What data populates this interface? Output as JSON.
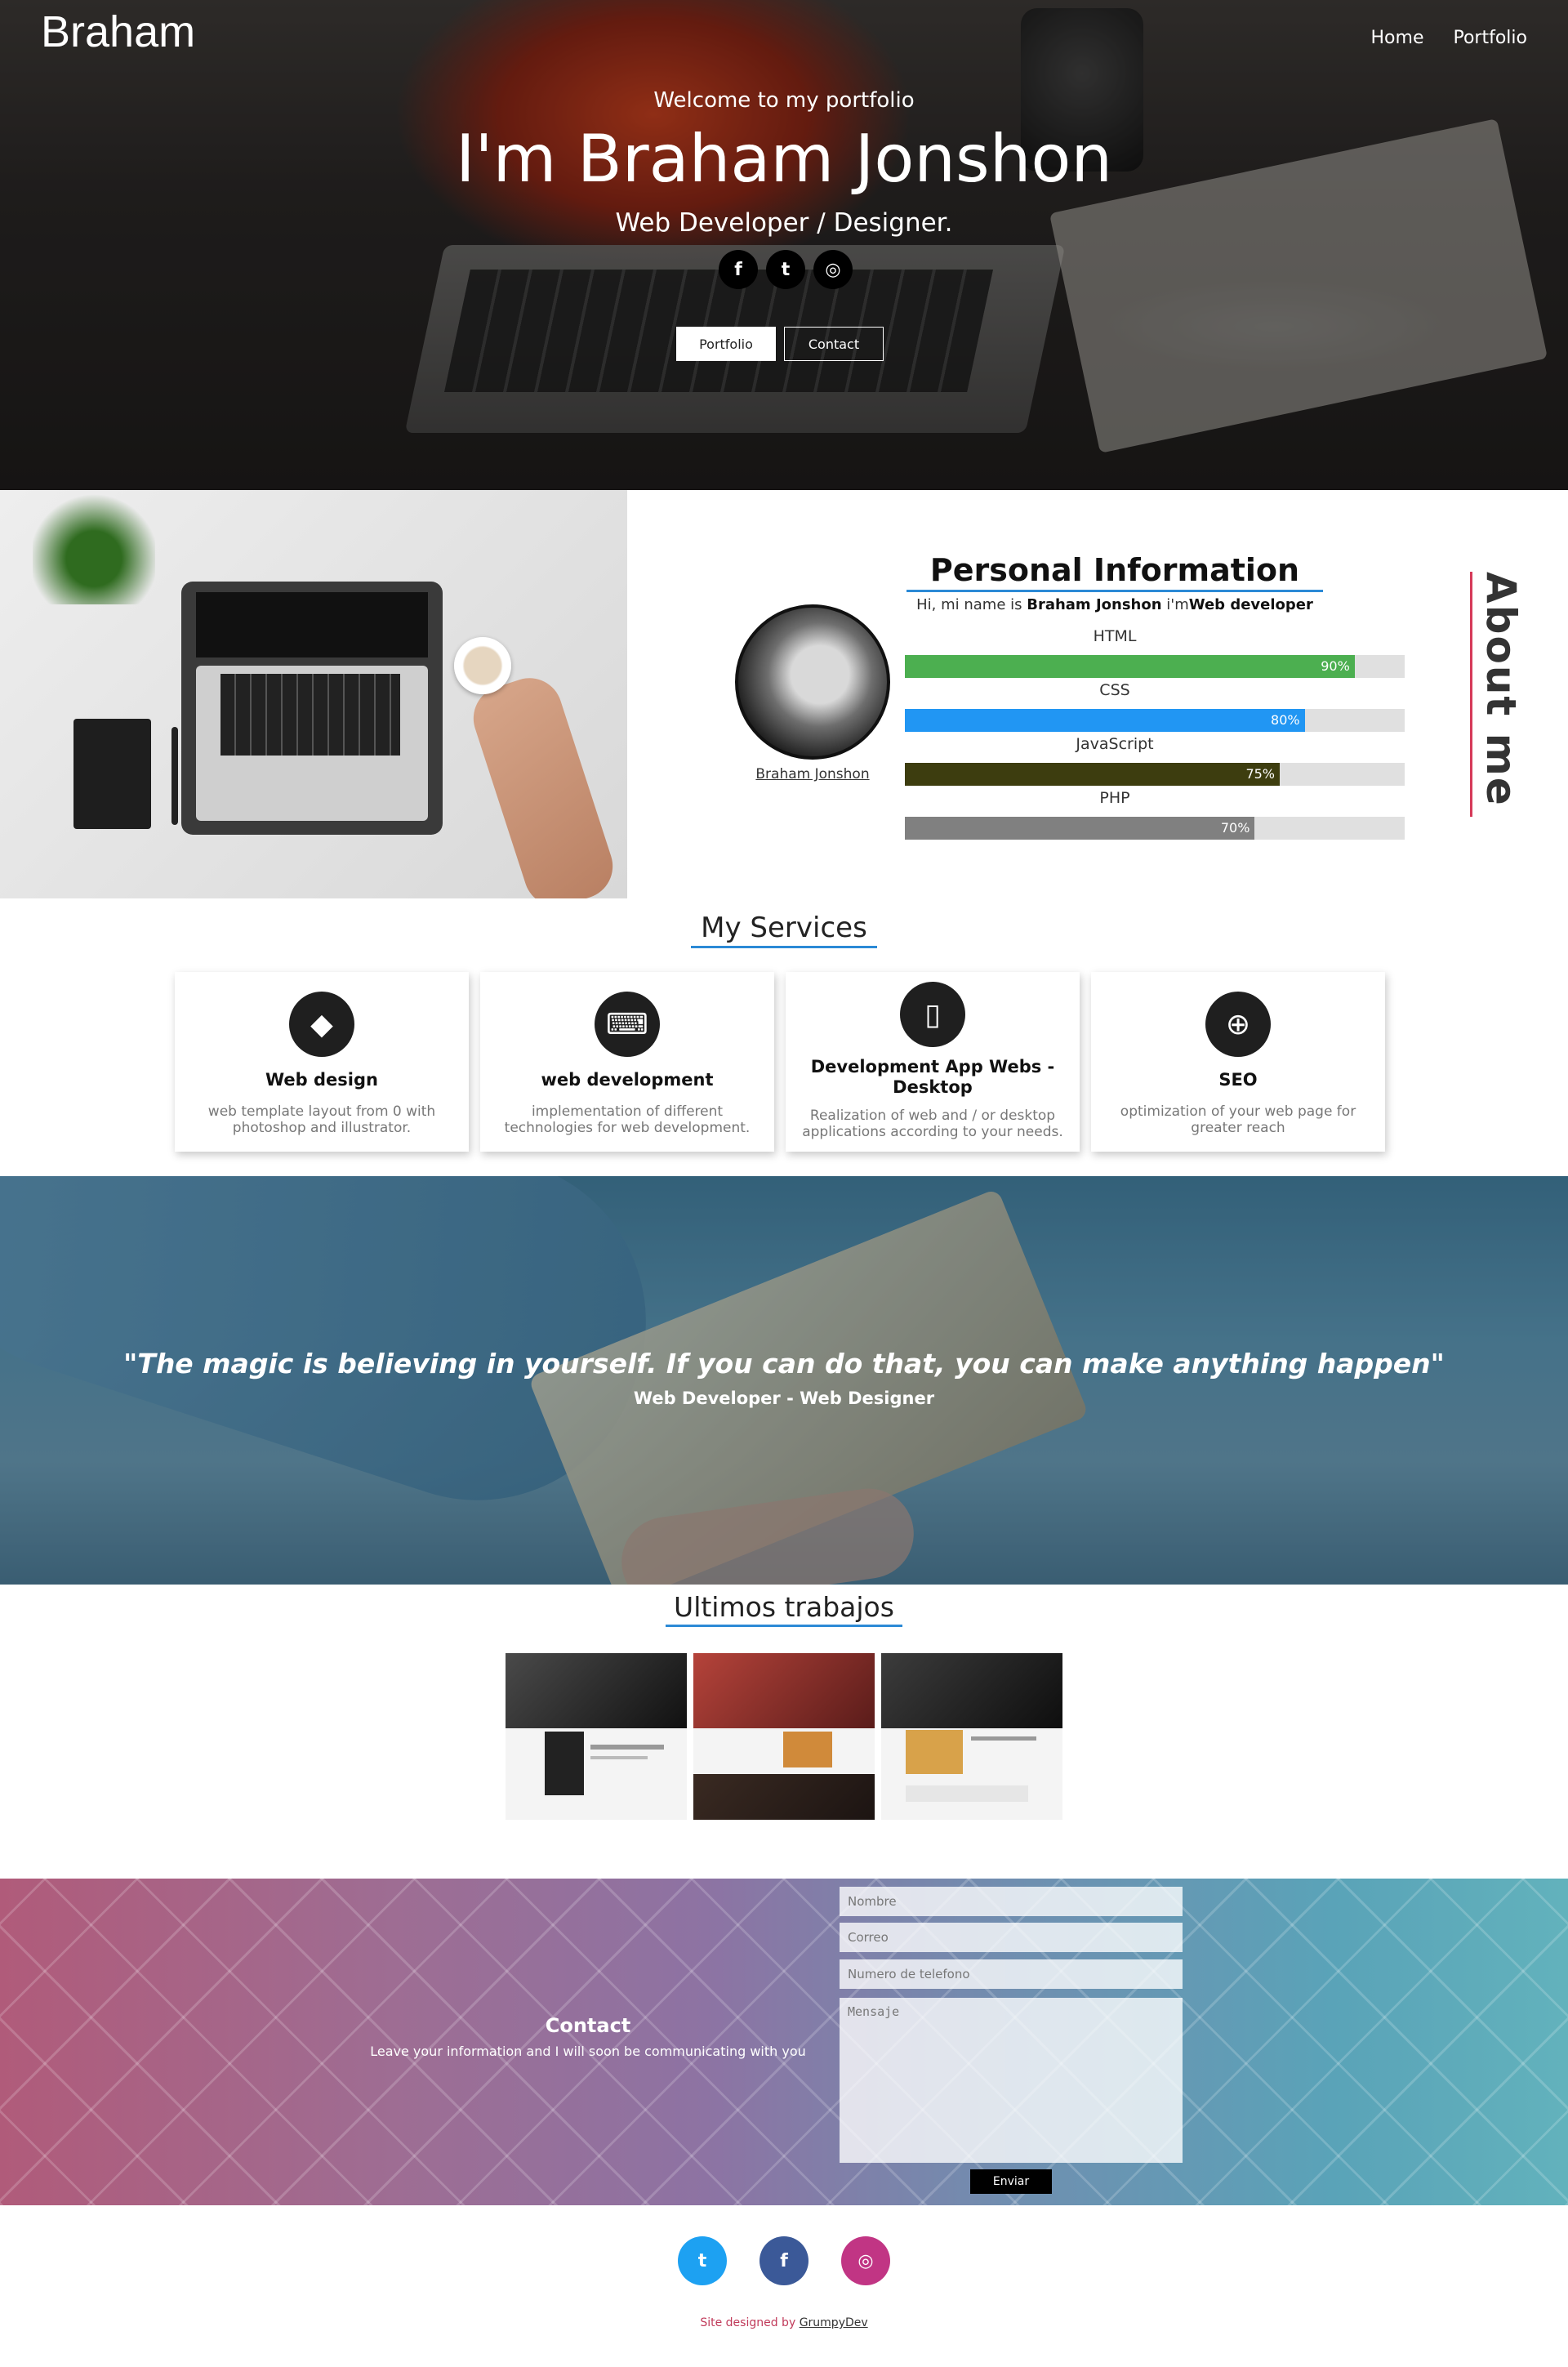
{
  "header": {
    "brand": "Braham",
    "nav": [
      {
        "label": "Home"
      },
      {
        "label": "Portfolio"
      }
    ]
  },
  "hero": {
    "welcome": "Welcome to my portfolio",
    "name": "I'm Braham Jonshon",
    "role": "Web Developer / Designer.",
    "socials": [
      {
        "icon": "facebook-icon",
        "glyph": "f"
      },
      {
        "icon": "twitter-icon",
        "glyph": "t"
      },
      {
        "icon": "instagram-icon",
        "glyph": "◎"
      }
    ],
    "buttons": {
      "portfolio": "Portfolio",
      "contact": "Contact"
    }
  },
  "about": {
    "title": "Personal Information",
    "intro_prefix": "Hi, mi name is ",
    "intro_name": "Braham Jonshon",
    "intro_mid": " i'm",
    "intro_role": "Web developer",
    "avatar_caption": "Braham Jonshon",
    "section_label": "About me",
    "skills": [
      {
        "label": "HTML",
        "percent": 90,
        "percent_text": "90%",
        "color": "#4caf50"
      },
      {
        "label": "CSS",
        "percent": 80,
        "percent_text": "80%",
        "color": "#2196f3"
      },
      {
        "label": "JavaScript",
        "percent": 75,
        "percent_text": "75%",
        "color": "#3d3d0f"
      },
      {
        "label": "PHP",
        "percent": 70,
        "percent_text": "70%",
        "color": "#808080"
      }
    ]
  },
  "services": {
    "title": "My Services",
    "items": [
      {
        "icon": "diamond-icon",
        "glyph": "◆",
        "title": "Web design",
        "desc": "web template layout from 0 with photoshop and illustrator."
      },
      {
        "icon": "code-monitor-icon",
        "glyph": "⌨",
        "title": "web development",
        "desc": "implementation of different technologies for web development."
      },
      {
        "icon": "mobile-icon",
        "glyph": "▯",
        "title": "Development App Webs - Desktop",
        "desc": "Realization of web and / or desktop applications according to your needs."
      },
      {
        "icon": "search-plus-icon",
        "glyph": "⊕",
        "title": "SEO",
        "desc": "optimization of your web page for greater reach"
      }
    ]
  },
  "quote": {
    "text": "\"The magic is believing in yourself. If you can do that, you can make anything happen\"",
    "sub": "Web Developer - Web Designer"
  },
  "works": {
    "title": "Ultimos trabajos"
  },
  "contact": {
    "title": "Contact",
    "subtitle": "Leave your information and I will soon be communicating with you",
    "name_placeholder": "Nombre",
    "email_placeholder": "Correo",
    "phone_placeholder": "Numero de telefono",
    "message_placeholder": "Mensaje",
    "send_label": "Enviar"
  },
  "footer": {
    "socials": [
      {
        "icon": "twitter-icon",
        "glyph": "t",
        "color": "#1da1f2"
      },
      {
        "icon": "facebook-icon",
        "glyph": "f",
        "color": "#3b5998"
      },
      {
        "icon": "instagram-icon",
        "glyph": "◎",
        "color": "#c13584"
      }
    ],
    "credit_prefix": "Site designed by ",
    "credit_link": "GrumpyDev"
  }
}
